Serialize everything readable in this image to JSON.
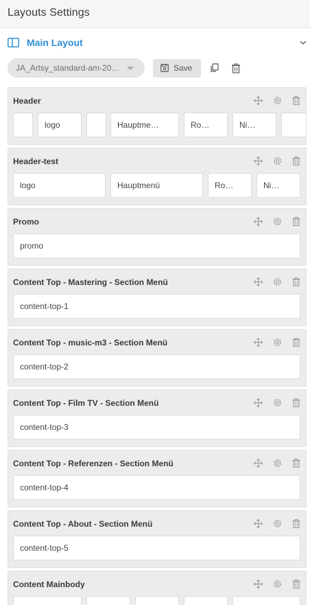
{
  "header": {
    "title": "Layouts Settings"
  },
  "section": {
    "label": "Main Layout"
  },
  "toolbar": {
    "layout_select_value": "JA_Artsy_standard-am-20…",
    "save_label": "Save"
  },
  "rows": [
    {
      "title": "Header",
      "columns": [
        "",
        "logo",
        "",
        "Hauptme…",
        "Ro…",
        "Ni…",
        ""
      ]
    },
    {
      "title": "Header-test",
      "columns": [
        "logo",
        "Hauptmenü",
        "Ro…",
        "Ni…"
      ]
    },
    {
      "title": "Promo",
      "columns": [
        "promo"
      ]
    },
    {
      "title": "Content Top - Mastering - Section Menü",
      "columns": [
        "content-top-1"
      ]
    },
    {
      "title": "Content Top - music-m3 - Section Menü",
      "columns": [
        "content-top-2"
      ]
    },
    {
      "title": "Content Top - Film TV - Section Menü",
      "columns": [
        "content-top-3"
      ]
    },
    {
      "title": "Content Top - Referenzen - Section Menü",
      "columns": [
        "content-top-4"
      ]
    },
    {
      "title": "Content Top - About - Section Menü",
      "columns": [
        "content-top-5"
      ]
    },
    {
      "title": "Content Mainbody",
      "columns": [
        "",
        "",
        "",
        "",
        ""
      ]
    }
  ],
  "colors": {
    "accent": "#2f8fd6",
    "row_bg": "#ececec",
    "panel_bg": "#f6f6f6"
  }
}
